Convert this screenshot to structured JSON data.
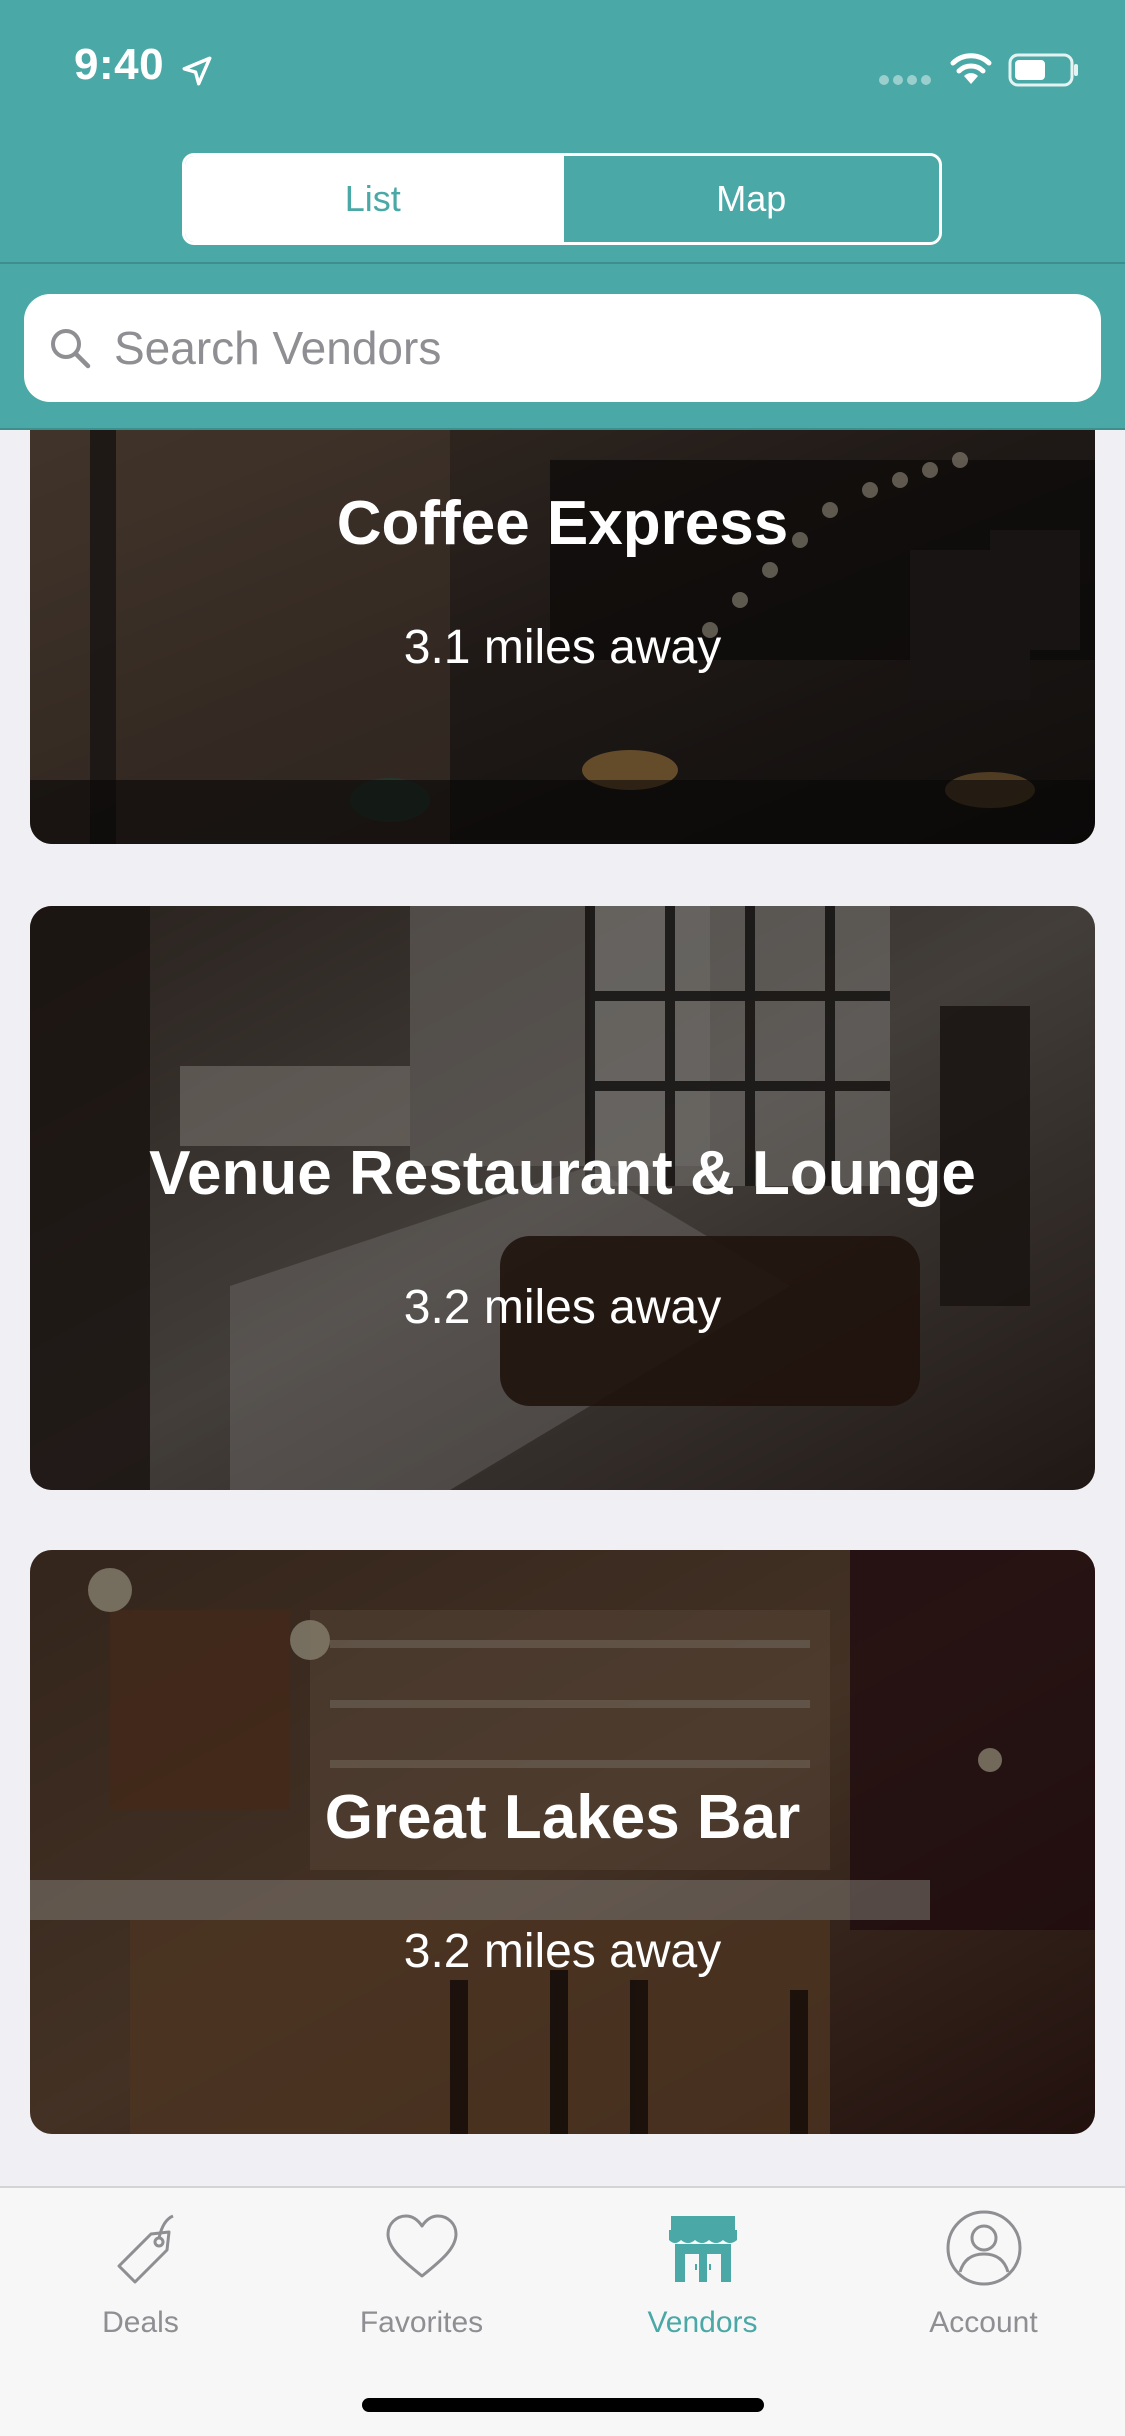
{
  "status_bar": {
    "time": "9:40"
  },
  "segmented": {
    "list_label": "List",
    "map_label": "Map",
    "selected": "List"
  },
  "search": {
    "placeholder": "Search Vendors"
  },
  "vendors": [
    {
      "name": "Coffee Express",
      "distance": "3.1 miles away"
    },
    {
      "name": "Venue Restaurant & Lounge",
      "distance": "3.2 miles away"
    },
    {
      "name": "Great Lakes Bar",
      "distance": "3.2 miles away"
    }
  ],
  "tabbar": {
    "items": [
      {
        "label": "Deals",
        "icon": "tag-icon"
      },
      {
        "label": "Favorites",
        "icon": "heart-icon"
      },
      {
        "label": "Vendors",
        "icon": "storefront-icon"
      },
      {
        "label": "Account",
        "icon": "person-icon"
      }
    ],
    "active": "Vendors"
  },
  "colors": {
    "accent": "#4aa8a6",
    "tab_inactive": "#8e8e93",
    "background": "#efeff4"
  }
}
